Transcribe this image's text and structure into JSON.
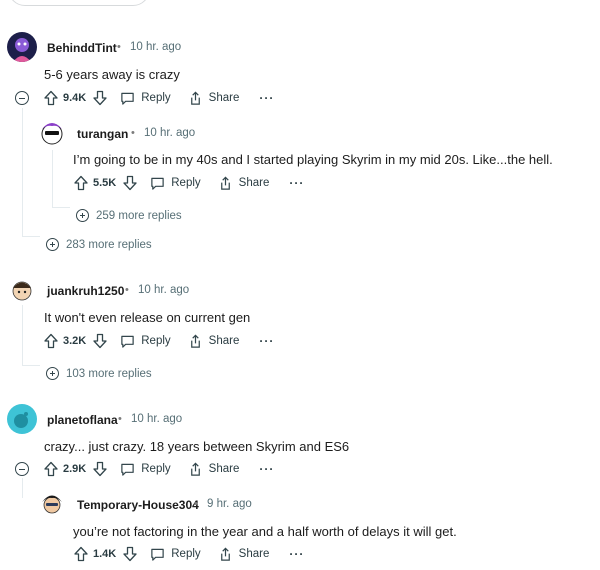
{
  "comments": [
    {
      "user": "BehinddTint",
      "time": "10 hr. ago",
      "text": "5-6 years away is crazy",
      "score": "9.4K"
    },
    {
      "user": "turangan",
      "time": "10 hr. ago",
      "text": "I’m going to be in my 40s and I started playing Skyrim in my mid 20s. Like...the hell.",
      "score": "5.5K"
    },
    {
      "user": "juankruh1250",
      "time": "10 hr. ago",
      "text": "It won't even release on current gen",
      "score": "3.2K"
    },
    {
      "user": "planetoflana",
      "time": "10 hr. ago",
      "text": "crazy... just crazy. 18 years between Skyrim and ES6",
      "score": "2.9K"
    },
    {
      "user": "Temporary-House304",
      "time": "9 hr. ago",
      "text": "you’re not factoring in the year and a half worth of delays it will get.",
      "score": "1.4K"
    }
  ],
  "more_replies": [
    "259 more replies",
    "283 more replies",
    "103 more replies"
  ],
  "labels": {
    "reply": "Reply",
    "share": "Share",
    "more": "···",
    "separator": "•"
  }
}
